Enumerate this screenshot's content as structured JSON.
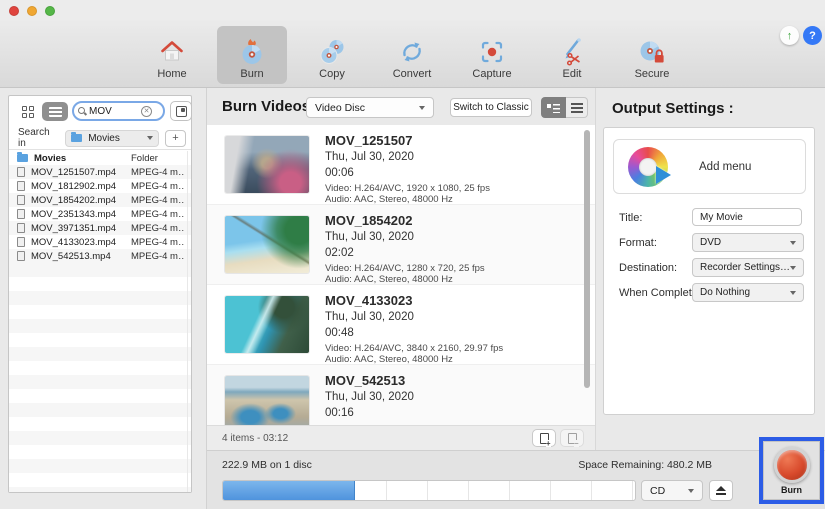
{
  "toolbar": {
    "items": [
      {
        "label": "Home"
      },
      {
        "label": "Burn"
      },
      {
        "label": "Copy"
      },
      {
        "label": "Convert"
      },
      {
        "label": "Capture"
      },
      {
        "label": "Edit"
      },
      {
        "label": "Secure"
      }
    ],
    "update_glyph": "↑",
    "help_glyph": "?"
  },
  "sidebar": {
    "search_value": "MOV",
    "clear_glyph": "✕",
    "search_in_label": "Search in",
    "location": "Movies",
    "add_button": "+",
    "files": [
      {
        "name": "Movies",
        "type": "Folder"
      },
      {
        "name": "MOV_1251507.mp4",
        "type": "MPEG-4 m…"
      },
      {
        "name": "MOV_1812902.mp4",
        "type": "MPEG-4 m…"
      },
      {
        "name": "MOV_1854202.mp4",
        "type": "MPEG-4 m…"
      },
      {
        "name": "MOV_2351343.mp4",
        "type": "MPEG-4 m…"
      },
      {
        "name": "MOV_3971351.mp4",
        "type": "MPEG-4 m…"
      },
      {
        "name": "MOV_4133023.mp4",
        "type": "MPEG-4 m…"
      },
      {
        "name": "MOV_542513.mp4",
        "type": "MPEG-4 m…"
      }
    ]
  },
  "main": {
    "title": "Burn Videos",
    "disc_menu": "Video Disc",
    "switch_button": "Switch to Classic",
    "summary": "4 items - 03:12",
    "videos": [
      {
        "name": "MOV_1251507",
        "date": "Thu, Jul 30, 2020",
        "duration": "00:06",
        "video": "Video: H.264/AVC, 1920 x 1080, 25 fps",
        "audio": "Audio: AAC, Stereo, 48000 Hz"
      },
      {
        "name": "MOV_1854202",
        "date": "Thu, Jul 30, 2020",
        "duration": "02:02",
        "video": "Video: H.264/AVC, 1280 x 720, 25 fps",
        "audio": "Audio: AAC, Stereo, 48000 Hz"
      },
      {
        "name": "MOV_4133023",
        "date": "Thu, Jul 30, 2020",
        "duration": "00:48",
        "video": "Video: H.264/AVC, 3840 x 2160, 29.97 fps",
        "audio": "Audio: AAC, Stereo, 48000 Hz"
      },
      {
        "name": "MOV_542513",
        "date": "Thu, Jul 30, 2020",
        "duration": "00:16"
      }
    ]
  },
  "output": {
    "heading": "Output Settings :",
    "add_menu_label": "Add menu",
    "title_label": "Title:",
    "title_value": "My Movie",
    "format_label": "Format:",
    "format_value": "DVD",
    "destination_label": "Destination:",
    "destination_value": "Recorder Settings…",
    "when_label": "When Complete:",
    "when_value": "Do Nothing"
  },
  "status": {
    "usage": "222.9 MB on 1 disc",
    "remaining": "Space Remaining: 480.2 MB",
    "progress_percent": 32,
    "media": "CD"
  },
  "burn_label": "Burn",
  "colors": {
    "accent_blue": "#4f93dd",
    "annotation_blue": "#2c5ce6",
    "burn_red": "#d84a2c",
    "selected_gray": "#c3c3c3"
  }
}
